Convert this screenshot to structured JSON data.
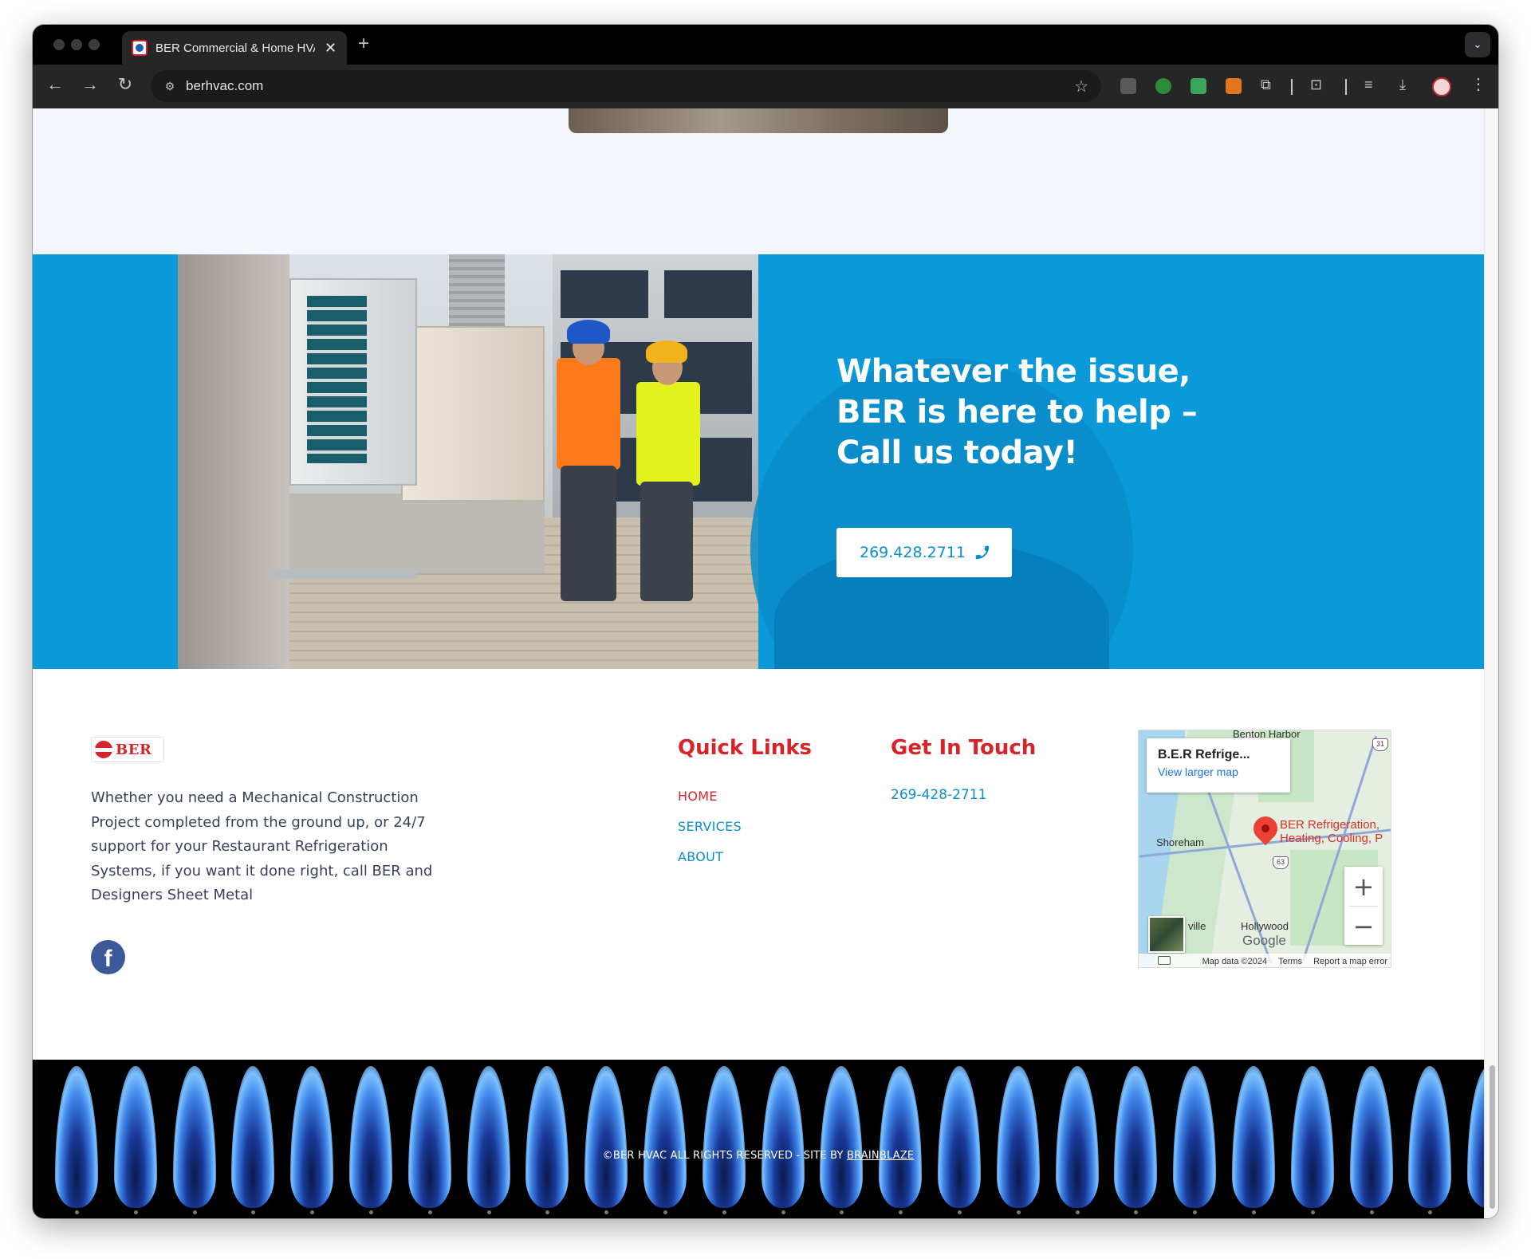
{
  "browser": {
    "tab_title": "BER Commercial & Home HVAC",
    "url": "berhvac.com"
  },
  "cta": {
    "heading_line1": "Whatever the issue,",
    "heading_line2": "BER is here to help –",
    "heading_line3": "Call us today!",
    "phone_button": "269.428.2711",
    "accent_color": "#0a9ad9"
  },
  "footer": {
    "logo_text": "BER",
    "about": "Whether you need a Mechanical Construction Project completed from the ground up, or 24/7 support for your Restaurant Refrigeration Systems, if you want it done right, call BER and Designers Sheet Metal",
    "quick_links_heading": "Quick Links",
    "quick_links": [
      "HOME",
      "SERVICES",
      "ABOUT"
    ],
    "get_in_touch_heading": "Get In Touch",
    "phone": "269-428-2711",
    "heading_color": "#d8232a",
    "link_color": "#0a8fce"
  },
  "map": {
    "card_title": "B.E.R Refrige...",
    "card_link": "View larger map",
    "place_label": "BER Refrigeration, Heating, Cooling, P",
    "labels": {
      "benton_harbor": "Benton Harbor",
      "shoreham": "Shoreham",
      "hollywood": "Hollywood",
      "ville": "ville",
      "route_31": "31",
      "route_63": "63"
    },
    "google": "Google",
    "map_data": "Map data ©2024",
    "terms": "Terms",
    "report": "Report a map error"
  },
  "copyright": {
    "text": "©BER HVAC ALL RIGHTS RESERVED - SITE BY ",
    "link": "BRAINBLAZE"
  }
}
